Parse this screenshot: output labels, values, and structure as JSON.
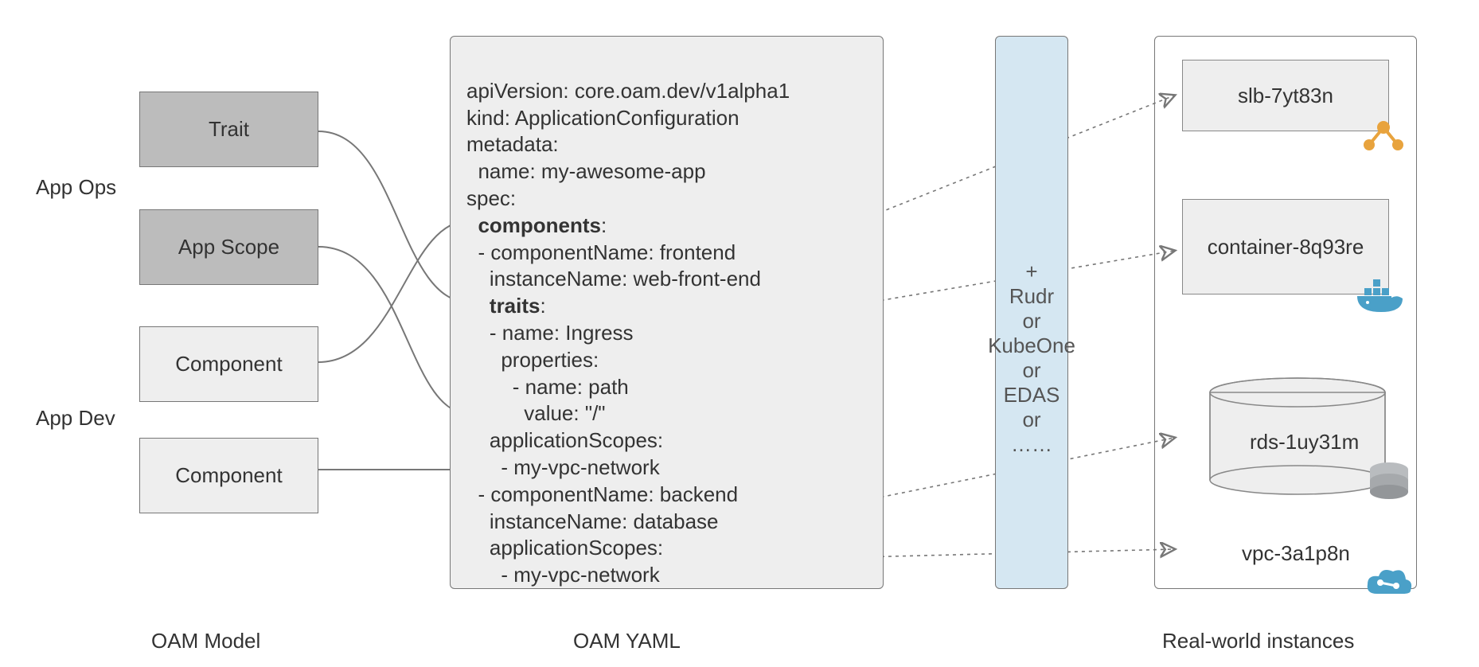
{
  "roleLabels": {
    "appOps": "App Ops",
    "appDev": "App Dev"
  },
  "modelBoxes": {
    "trait": "Trait",
    "appScope": "App Scope",
    "component1": "Component",
    "component2": "Component"
  },
  "columnTitles": {
    "model": "OAM Model",
    "yaml": "OAM YAML",
    "instances": "Real-world instances"
  },
  "yaml": {
    "l01": "apiVersion: core.oam.dev/v1alpha1",
    "l02": "kind: ApplicationConfiguration",
    "l03": "metadata:",
    "l04": "  name: my-awesome-app",
    "l05": "spec:",
    "l06": "  components:",
    "l07": "  - componentName: frontend",
    "l08": "    instanceName: web-front-end",
    "l09": "    traits:",
    "l10": "    - name: Ingress",
    "l11": "      properties:",
    "l12": "        - name: path",
    "l13": "          value: \"/\"",
    "l14": "    applicationScopes:",
    "l15": "      - my-vpc-network",
    "l16": "  - componentName: backend",
    "l17": "    instanceName: database",
    "l18": "    applicationScopes:",
    "l19": "      - my-vpc-network"
  },
  "runtime": {
    "plus": "+",
    "l1": "Rudr",
    "or": "or",
    "l2": "KubeOne",
    "l3": "EDAS",
    "ellipsis": "……"
  },
  "instances": {
    "slb": "slb-7yt83n",
    "container": "container-8q93re",
    "rds": "rds-1uy31m",
    "vpc": "vpc-3a1p8n"
  },
  "colors": {
    "boxDark": "#bcbcbc",
    "boxLight": "#eeeeee",
    "runtimeBlue": "#d5e7f2",
    "k8sBlue": "#3a6fcf",
    "dockerBlue": "#4aa0c8",
    "orangeIcon": "#e8a33d",
    "dbGrey": "#b9bcbf",
    "cloudBlue": "#4aa0c8"
  }
}
